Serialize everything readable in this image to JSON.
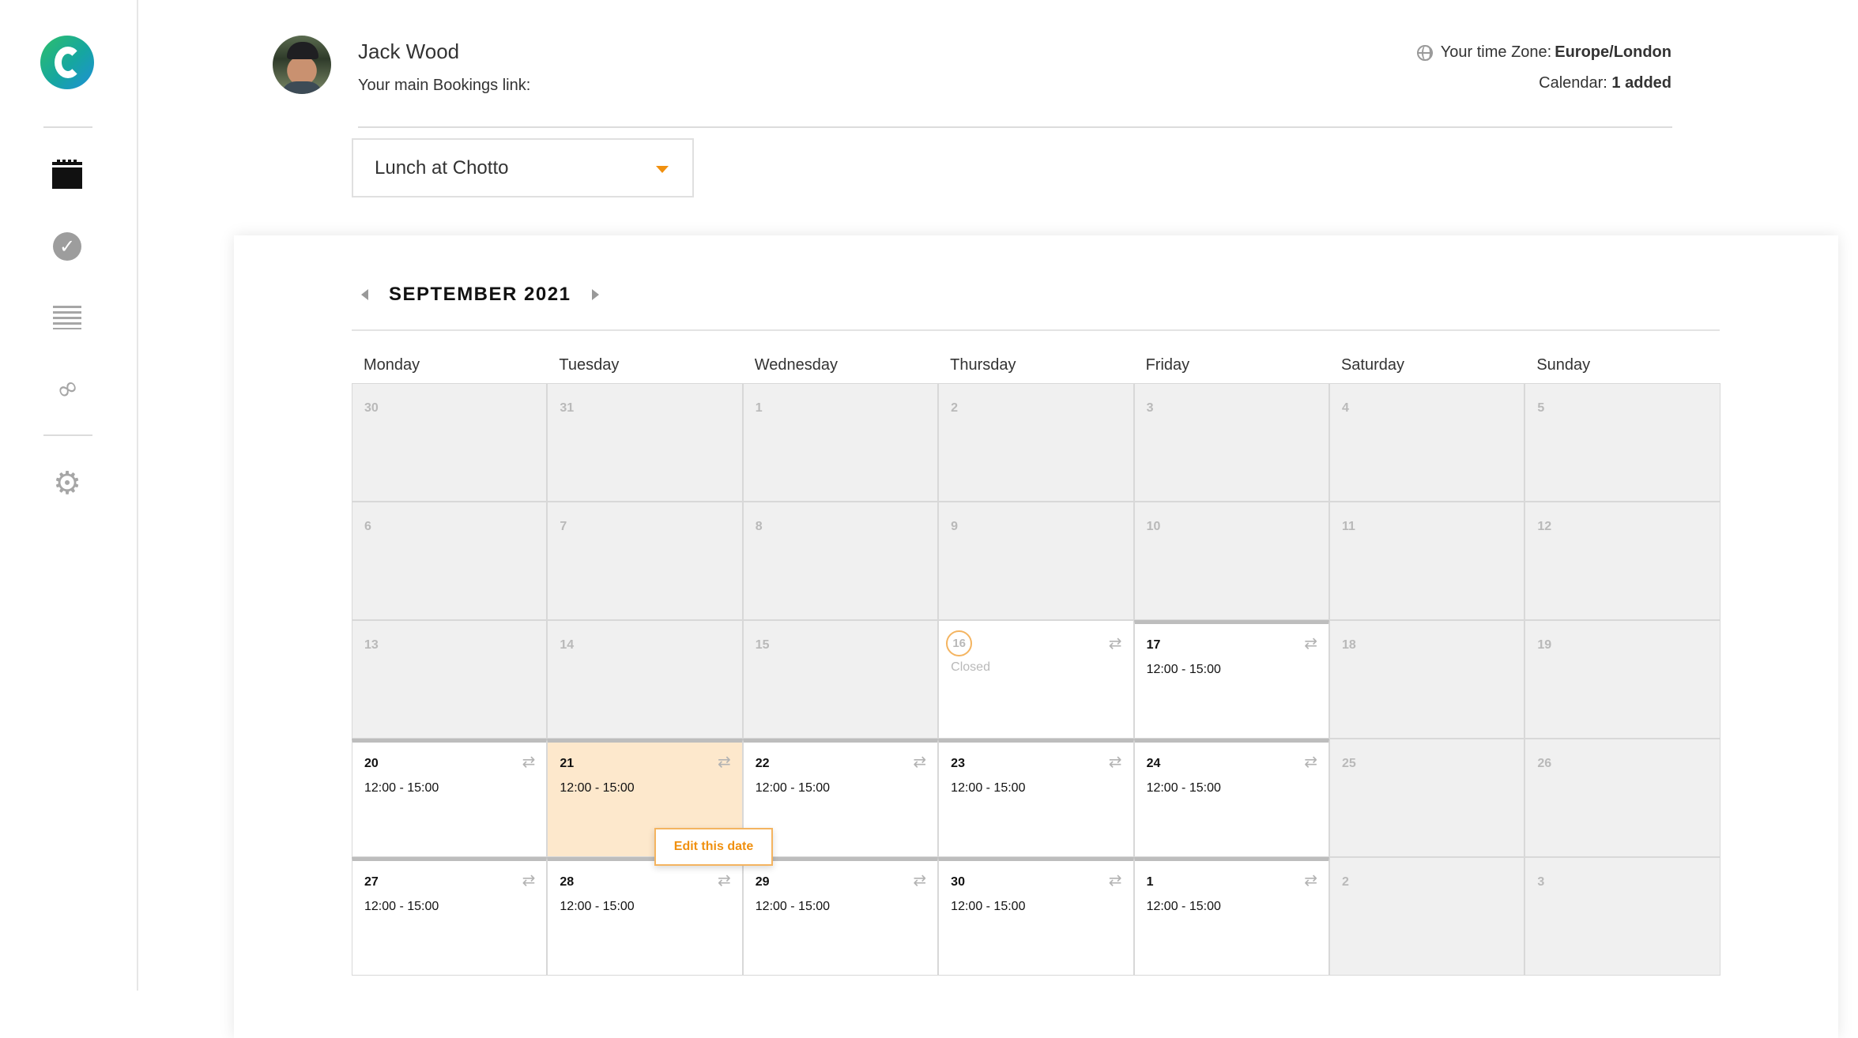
{
  "user": {
    "name": "Jack Wood",
    "booking_link_label": "Your main Bookings link:"
  },
  "timezone": {
    "label": "Your time Zone:",
    "value": "Europe/London"
  },
  "calendar_info": {
    "label": "Calendar:",
    "value": "1 added"
  },
  "event_select": {
    "value": "Lunch at Chotto"
  },
  "calendar": {
    "month_label": "SEPTEMBER 2021",
    "weekdays": [
      "Monday",
      "Tuesday",
      "Wednesday",
      "Thursday",
      "Friday",
      "Saturday",
      "Sunday"
    ],
    "weeks": [
      [
        {
          "day": "30",
          "state": "inactive"
        },
        {
          "day": "31",
          "state": "inactive"
        },
        {
          "day": "1",
          "state": "inactive"
        },
        {
          "day": "2",
          "state": "inactive"
        },
        {
          "day": "3",
          "state": "inactive"
        },
        {
          "day": "4",
          "state": "inactive"
        },
        {
          "day": "5",
          "state": "inactive"
        }
      ],
      [
        {
          "day": "6",
          "state": "inactive"
        },
        {
          "day": "7",
          "state": "inactive"
        },
        {
          "day": "8",
          "state": "inactive"
        },
        {
          "day": "9",
          "state": "inactive"
        },
        {
          "day": "10",
          "state": "inactive"
        },
        {
          "day": "11",
          "state": "inactive"
        },
        {
          "day": "12",
          "state": "inactive"
        }
      ],
      [
        {
          "day": "13",
          "state": "inactive"
        },
        {
          "day": "14",
          "state": "inactive"
        },
        {
          "day": "15",
          "state": "inactive"
        },
        {
          "day": "16",
          "state": "closed",
          "status": "Closed"
        },
        {
          "day": "17",
          "state": "active",
          "time": "12:00 - 15:00"
        },
        {
          "day": "18",
          "state": "inactive"
        },
        {
          "day": "19",
          "state": "inactive"
        }
      ],
      [
        {
          "day": "20",
          "state": "active",
          "time": "12:00 - 15:00"
        },
        {
          "day": "21",
          "state": "active",
          "time": "12:00 - 15:00",
          "highlight": true
        },
        {
          "day": "22",
          "state": "active",
          "time": "12:00 - 15:00"
        },
        {
          "day": "23",
          "state": "active",
          "time": "12:00 - 15:00"
        },
        {
          "day": "24",
          "state": "active",
          "time": "12:00 - 15:00"
        },
        {
          "day": "25",
          "state": "inactive"
        },
        {
          "day": "26",
          "state": "inactive"
        }
      ],
      [
        {
          "day": "27",
          "state": "active",
          "time": "12:00 - 15:00"
        },
        {
          "day": "28",
          "state": "active",
          "time": "12:00 - 15:00"
        },
        {
          "day": "29",
          "state": "active",
          "time": "12:00 - 15:00"
        },
        {
          "day": "30",
          "state": "active",
          "time": "12:00 - 15:00"
        },
        {
          "day": "1",
          "state": "active",
          "time": "12:00 - 15:00"
        },
        {
          "day": "2",
          "state": "inactive"
        },
        {
          "day": "3",
          "state": "inactive"
        }
      ]
    ]
  },
  "tooltip": {
    "label": "Edit this date"
  },
  "icons": {
    "nav": [
      "calendar-icon",
      "check-icon",
      "list-icon",
      "link-icon",
      "gear-icon"
    ],
    "repeat": "⇄"
  },
  "colors": {
    "accent": "#f0900f",
    "highlight_bg": "#fde8cc",
    "inactive_bg": "#f0f0f0"
  }
}
